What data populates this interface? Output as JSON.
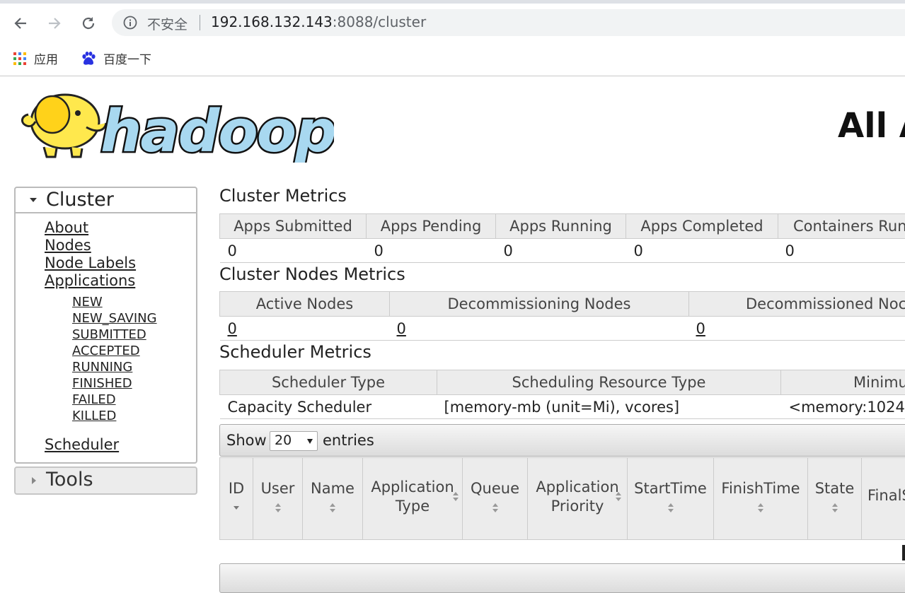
{
  "browser": {
    "security_label": "不安全",
    "url_host": "192.168.132.143",
    "url_rest": ":8088/cluster",
    "bookmarks": [
      {
        "label": "应用",
        "icon": "apps-grid-icon"
      },
      {
        "label": "百度一下",
        "icon": "baidu-paw-icon"
      }
    ]
  },
  "page": {
    "logo_text": "hadoop",
    "title": "All A"
  },
  "nav": {
    "cluster_label": "Cluster",
    "links": {
      "about": "About",
      "nodes": "Nodes",
      "node_labels": "Node Labels",
      "applications": "Applications",
      "scheduler": "Scheduler"
    },
    "app_states": [
      "NEW",
      "NEW_SAVING",
      "SUBMITTED",
      "ACCEPTED",
      "RUNNING",
      "FINISHED",
      "FAILED",
      "KILLED"
    ],
    "tools_label": "Tools"
  },
  "cluster_metrics": {
    "title": "Cluster Metrics",
    "headers": [
      "Apps Submitted",
      "Apps Pending",
      "Apps Running",
      "Apps Completed",
      "Containers Run"
    ],
    "values": [
      "0",
      "0",
      "0",
      "0",
      "0"
    ]
  },
  "node_metrics": {
    "title": "Cluster Nodes Metrics",
    "headers": [
      "Active Nodes",
      "Decommissioning Nodes",
      "Decommissioned Noc"
    ],
    "values": [
      "0",
      "0",
      "0"
    ]
  },
  "scheduler_metrics": {
    "title": "Scheduler Metrics",
    "headers": [
      "Scheduler Type",
      "Scheduling Resource Type",
      "Minimu"
    ],
    "values": [
      "Capacity Scheduler",
      "[memory-mb (unit=Mi), vcores]",
      "<memory:1024,"
    ]
  },
  "app_table": {
    "show_label": "Show",
    "page_size": "20",
    "entries_label": "entries",
    "columns": [
      {
        "line1": "ID",
        "line2": ""
      },
      {
        "line1": "User",
        "line2": ""
      },
      {
        "line1": "Name",
        "line2": ""
      },
      {
        "line1": "Application",
        "line2": "Type"
      },
      {
        "line1": "Queue",
        "line2": ""
      },
      {
        "line1": "Application",
        "line2": "Priority"
      },
      {
        "line1": "StartTime",
        "line2": ""
      },
      {
        "line1": "FinishTime",
        "line2": ""
      },
      {
        "line1": "State",
        "line2": ""
      },
      {
        "line1": "FinalS",
        "line2": ""
      }
    ]
  }
}
